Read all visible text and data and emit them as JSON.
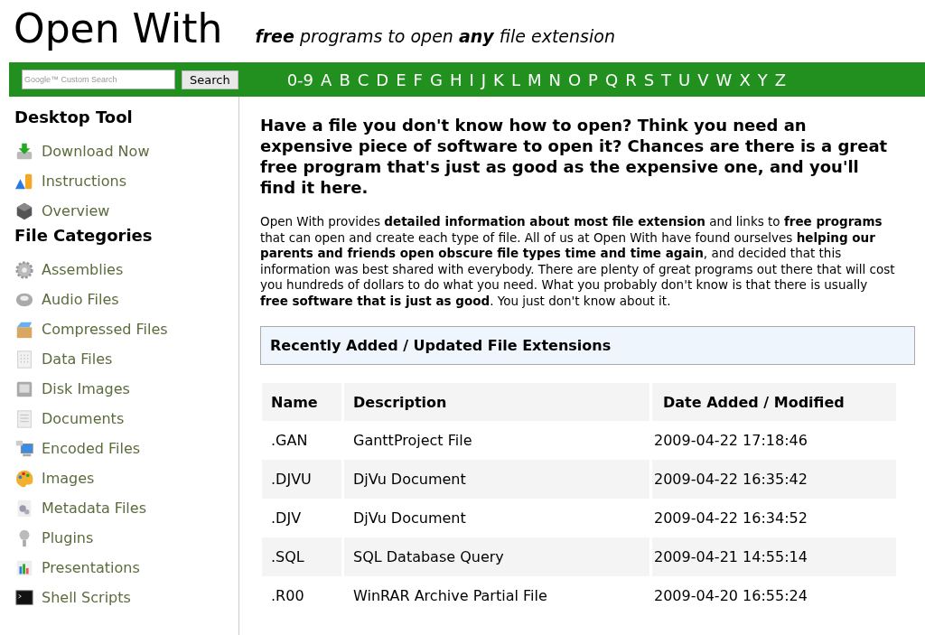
{
  "header": {
    "title": "Open With",
    "tagline": "**free** programs to open **any** file extension"
  },
  "search": {
    "placeholder": "Google™ Custom Search",
    "button": "Search"
  },
  "letters": [
    "0-9",
    "A",
    "B",
    "C",
    "D",
    "E",
    "F",
    "G",
    "H",
    "I",
    "J",
    "K",
    "L",
    "M",
    "N",
    "O",
    "P",
    "Q",
    "R",
    "S",
    "T",
    "U",
    "V",
    "W",
    "X",
    "Y",
    "Z"
  ],
  "sidebar": [
    {
      "heading": "Desktop Tool",
      "items": [
        "Download Now",
        "Instructions",
        "Overview"
      ]
    },
    {
      "heading": "File Categories",
      "items": [
        "Assemblies",
        "Audio Files",
        "Compressed Files",
        "Data Files",
        "Disk Images",
        "Documents",
        "Encoded Files",
        "Images",
        "Metadata Files",
        "Plugins",
        "Presentations",
        "Shell Scripts"
      ]
    }
  ],
  "intro": {
    "heading": "Have a file you don't know how to open? Think you need an expensive piece of software to open it? Chances are there is a great free program that's just as good as the expensive one, and you'll find it here.",
    "paragraph": "Open With provides **detailed information about most file extension** and links to **free programs** that can open and create each type of file. All of us at Open With have found ourselves **helping our parents and friends open obscure file types time and time again**, and decided that this information was best shared with everybody. There are plenty of great programs out there that will cost you hundreds of dollars to do what you need. What you probably don't know is that there is usually **free software that is just as good**. You just don't know about it."
  },
  "recent": {
    "title": "Recently Added / Updated File Extensions",
    "columns": [
      "Name",
      "Description",
      "Date Added / Modified"
    ],
    "rows": [
      [
        ".GAN",
        "GanttProject File",
        "2009-04-22 17:18:46"
      ],
      [
        ".DJVU",
        "DjVu Document",
        "2009-04-22 16:35:42"
      ],
      [
        ".DJV",
        "DjVu Document",
        "2009-04-22 16:34:52"
      ],
      [
        ".SQL",
        "SQL Database Query",
        "2009-04-21 14:55:14"
      ],
      [
        ".R00",
        "WinRAR Archive Partial File",
        "2009-04-20 16:55:24"
      ]
    ]
  }
}
